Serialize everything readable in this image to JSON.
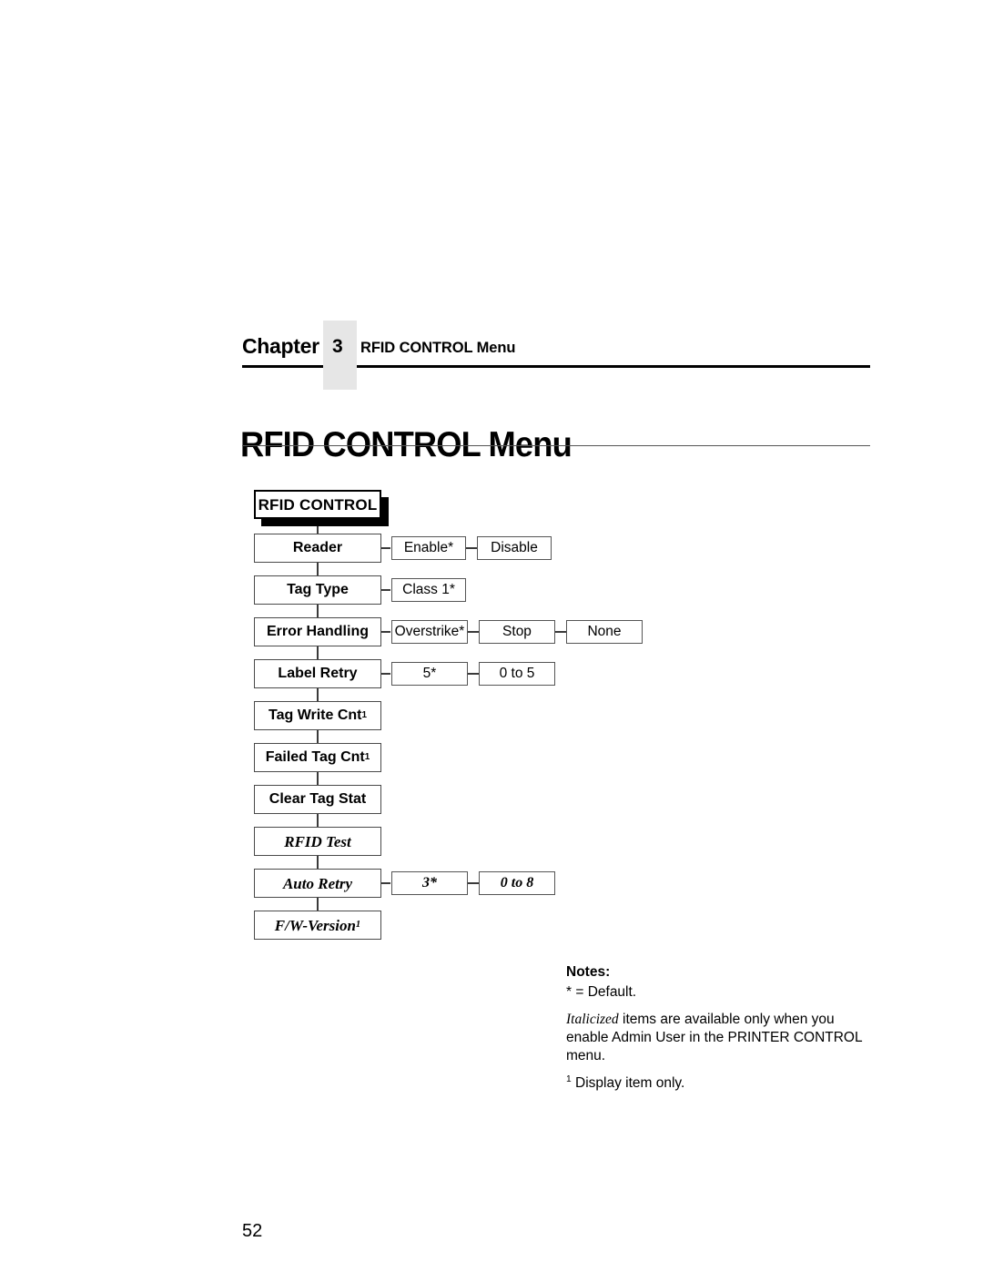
{
  "header": {
    "chapter_word": "Chapter",
    "chapter_number": "3",
    "running_title": "RFID CONTROL Menu"
  },
  "title": "RFID CONTROL Menu",
  "diagram": {
    "root": {
      "label": "RFID CONTROL"
    },
    "menu_items": [
      {
        "label": "Reader",
        "sup": "",
        "italic": false,
        "values": [
          {
            "label": "Enable*"
          },
          {
            "label": "Disable"
          }
        ]
      },
      {
        "label": "Tag Type",
        "sup": "",
        "italic": false,
        "values": [
          {
            "label": "Class 1*"
          }
        ]
      },
      {
        "label": "Error Handling",
        "sup": "",
        "italic": false,
        "values": [
          {
            "label": "Overstrike*"
          },
          {
            "label": "Stop"
          },
          {
            "label": "None"
          }
        ]
      },
      {
        "label": "Label Retry",
        "sup": "",
        "italic": false,
        "values": [
          {
            "label": "5*"
          },
          {
            "label": "0 to 5"
          }
        ]
      },
      {
        "label": "Tag Write Cnt",
        "sup": "1",
        "italic": false,
        "values": []
      },
      {
        "label": "Failed Tag Cnt",
        "sup": "1",
        "italic": false,
        "values": []
      },
      {
        "label": "Clear Tag Stat",
        "sup": "",
        "italic": false,
        "values": []
      },
      {
        "label": "RFID Test",
        "sup": "",
        "italic": true,
        "values": []
      },
      {
        "label": "Auto Retry",
        "sup": "",
        "italic": true,
        "values": [
          {
            "label": "3*"
          },
          {
            "label": "0 to 8"
          }
        ]
      },
      {
        "label": "F/W-Version",
        "sup": "1",
        "italic": true,
        "values": []
      }
    ]
  },
  "notes": {
    "heading": "Notes:",
    "default_note": "* = Default.",
    "italic_word": "Italicized",
    "italic_note_rest": " items are available only when you enable Admin User in the PRINTER CONTROL menu.",
    "superscript_marker": "1",
    "display_note": " Display item only."
  },
  "folio": "52",
  "colors": {
    "tab_gray": "#e6e6e6",
    "rule_black": "#000000",
    "box_border": "#4f4f4f",
    "text": "#000000"
  }
}
